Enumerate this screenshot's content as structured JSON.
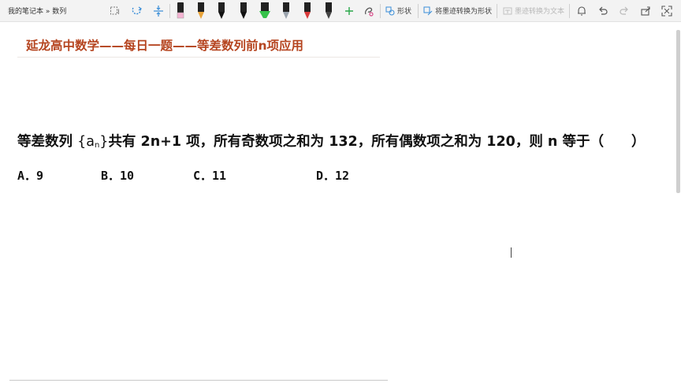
{
  "breadcrumb": "我的笔记本 » 数列",
  "toolbar": {
    "shape_label": "形状",
    "ink_to_shape_label": "将墨迹转换为形状",
    "ink_to_text_label": "墨迹转换为文本",
    "pen_colors": [
      "#f4b3d2",
      "#e8a33a",
      "#111111",
      "#111111",
      "#111111",
      "#36c24a",
      "#9aa3ad",
      "#d93b3b",
      "#444444"
    ]
  },
  "page": {
    "title": "延龙高中数学——每日一题——等差数列前n项应用",
    "question": {
      "part1": "等差数列",
      "seq_open": "{a",
      "seq_sub": "n",
      "seq_close": "}",
      "part2": "共有 2n+1 项，所有奇数项之和为 132，所有偶数项之和为 120，则 n 等于（　　）"
    },
    "options": {
      "a": "A．9",
      "b": "B．10",
      "c": "C．11",
      "d": "D．12"
    }
  }
}
